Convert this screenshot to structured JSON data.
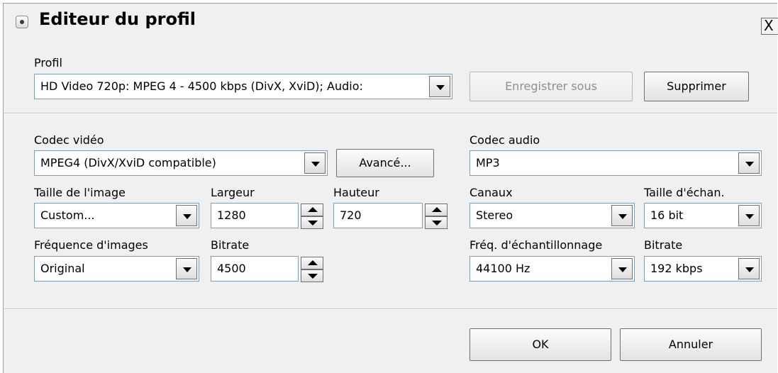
{
  "window": {
    "title": "Editeur du profil",
    "close_label": "X"
  },
  "profile": {
    "label": "Profil",
    "value": "HD Video 720p: MPEG 4 - 4500 kbps (DivX, XviD); Audio:",
    "save_as_label": "Enregistrer sous",
    "delete_label": "Supprimer"
  },
  "video": {
    "codec_label": "Codec vidéo",
    "codec_value": "MPEG4 (DivX/XviD compatible)",
    "advanced_label": "Avancé...",
    "size_label": "Taille de l'image",
    "size_value": "Custom...",
    "width_label": "Largeur",
    "width_value": "1280",
    "height_label": "Hauteur",
    "height_value": "720",
    "framerate_label": "Fréquence d'images",
    "framerate_value": "Original",
    "bitrate_label": "Bitrate",
    "bitrate_value": "4500"
  },
  "audio": {
    "codec_label": "Codec audio",
    "codec_value": "MP3",
    "channels_label": "Canaux",
    "channels_value": "Stereo",
    "sample_size_label": "Taille d'échan.",
    "sample_size_value": "16 bit",
    "sample_rate_label": "Fréq. d'échantillonnage",
    "sample_rate_value": "44100 Hz",
    "bitrate_label": "Bitrate",
    "bitrate_value": "192 kbps"
  },
  "footer": {
    "ok_label": "OK",
    "cancel_label": "Annuler"
  }
}
